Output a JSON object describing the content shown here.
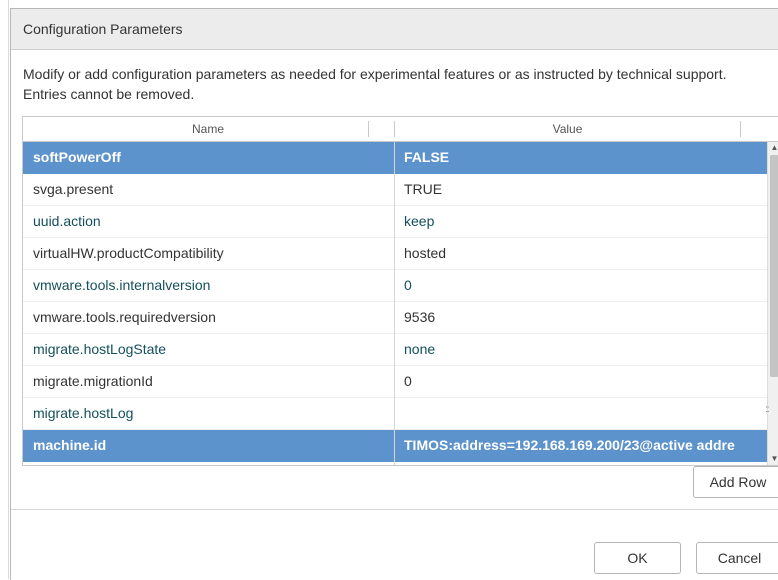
{
  "dialog": {
    "title": "Configuration Parameters",
    "description": "Modify or add configuration parameters as needed for experimental features or as instructed by technical support. Entries cannot be removed."
  },
  "grid": {
    "columns": {
      "name": "Name",
      "value": "Value"
    },
    "rows": [
      {
        "name": "softPowerOff",
        "value": "FALSE",
        "selected": true,
        "accent": false
      },
      {
        "name": "svga.present",
        "value": "TRUE",
        "selected": false,
        "accent": false
      },
      {
        "name": "uuid.action",
        "value": "keep",
        "selected": false,
        "accent": true
      },
      {
        "name": "virtualHW.productCompatibility",
        "value": "hosted",
        "selected": false,
        "accent": false
      },
      {
        "name": "vmware.tools.internalversion",
        "value": "0",
        "selected": false,
        "accent": true
      },
      {
        "name": "vmware.tools.requiredversion",
        "value": "9536",
        "selected": false,
        "accent": false
      },
      {
        "name": "migrate.hostLogState",
        "value": "none",
        "selected": false,
        "accent": true
      },
      {
        "name": "migrate.migrationId",
        "value": "0",
        "selected": false,
        "accent": false
      },
      {
        "name": "migrate.hostLog",
        "value": "",
        "selected": false,
        "accent": true
      },
      {
        "name": "machine.id",
        "value": "TIMOS:address=192.168.169.200/23@active addre",
        "selected": true,
        "accent": false
      }
    ]
  },
  "buttons": {
    "add_row": "Add Row",
    "ok": "OK",
    "cancel": "Cancel"
  },
  "icons": {
    "scroll_up": "triangle-up-icon",
    "scroll_down": "triangle-down-icon",
    "resize_grip": "grip-icon"
  },
  "colors": {
    "selection": "#5d93cc",
    "accent_text": "#14505c",
    "title_bar": "#ececec"
  }
}
